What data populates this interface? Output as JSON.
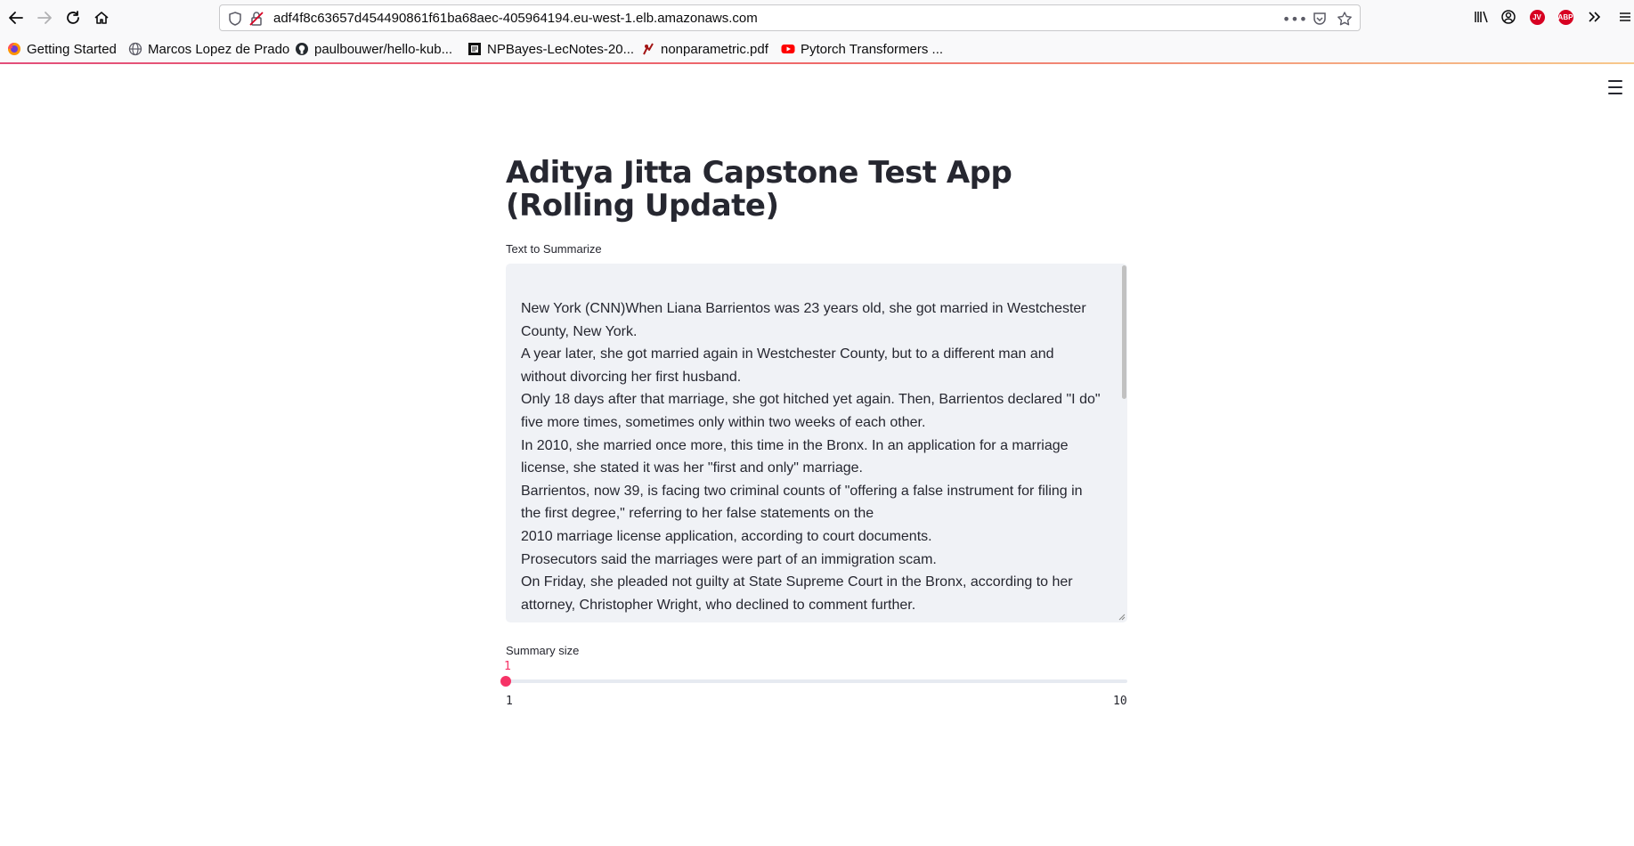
{
  "browser": {
    "url": "adf4f8c63657d454490861f61ba68aec-405964194.eu-west-1.elb.amazonaws.com",
    "bookmarks": [
      {
        "label": "Getting Started",
        "icon": "firefox-icon"
      },
      {
        "label": "Marcos Lopez de Prado",
        "icon": "globe-icon"
      },
      {
        "label": "paulbouwer/hello-kub...",
        "icon": "github-icon"
      },
      {
        "label": "NPBayes-LecNotes-20...",
        "icon": "document-icon"
      },
      {
        "label": "nonparametric.pdf",
        "icon": "pdf-icon"
      },
      {
        "label": "Pytorch Transformers ...",
        "icon": "youtube-icon"
      }
    ],
    "addon_labels": {
      "jv": "JV",
      "abp": "ABP"
    },
    "accent": "#f63366"
  },
  "page": {
    "title": "Aditya Jitta Capstone Test App (Rolling Update)",
    "text_label": "Text to Summarize",
    "text_lines": [
      "New York (CNN)When Liana Barrientos was 23 years old, she got married in Westchester County, New York.",
      "A year later, she got married again in Westchester County, but to a different man and without divorcing her first husband.",
      "Only 18 days after that marriage, she got hitched yet again. Then, Barrientos declared \"I do\" five more times, sometimes only within two weeks of each other.",
      "In 2010, she married once more, this time in the Bronx. In an application for a marriage license, she stated it was her \"first and only\" marriage.",
      "Barrientos, now 39, is facing two criminal counts of \"offering a false instrument for filing in the first degree,\" referring to her false statements on the",
      "2010 marriage license application, according to court documents.",
      "Prosecutors said the marriages were part of an immigration scam.",
      "On Friday, she pleaded not guilty at State Supreme Court in the Bronx, according to her attorney, Christopher Wright, who declined to comment further."
    ],
    "slider": {
      "label": "Summary size",
      "value": "1",
      "min": "1",
      "max": "10",
      "fraction": 0
    }
  }
}
